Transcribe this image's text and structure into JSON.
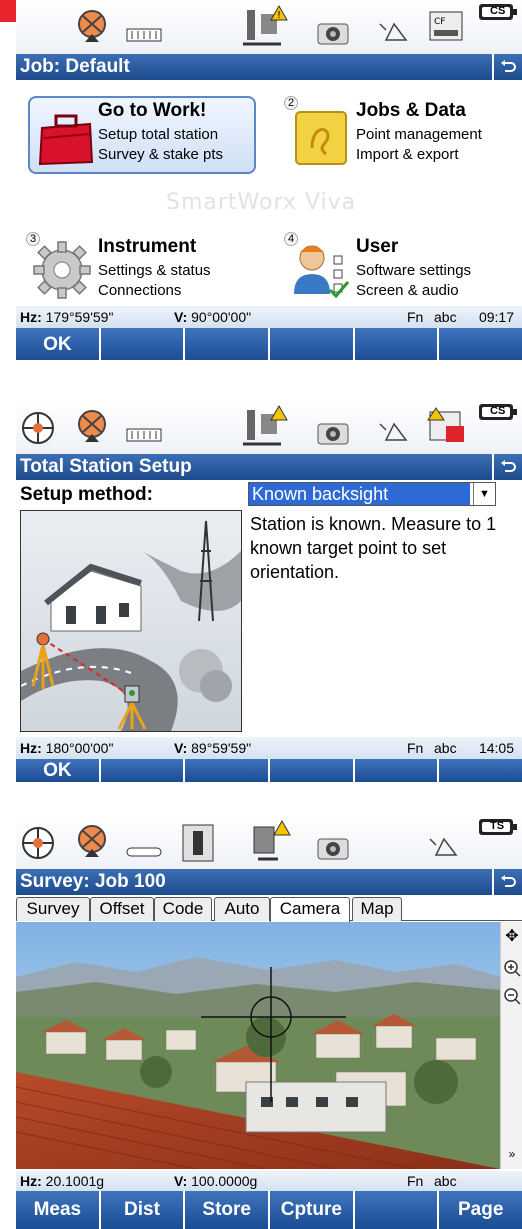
{
  "colors": {
    "accent_red": "#e8252c",
    "title_blue": "#1d4a8d",
    "selection_blue": "#2e6ad6"
  },
  "screen1": {
    "title": "Job: Default",
    "tiles": [
      {
        "number": "",
        "title": "Go to Work!",
        "line1": "Setup total station",
        "line2": "Survey & stake pts",
        "icon": "briefcase-icon"
      },
      {
        "number": "2",
        "title": "Jobs & Data",
        "line1": "Point management",
        "line2": "Import & export",
        "icon": "folder-icon"
      },
      {
        "number": "3",
        "title": "Instrument",
        "line1": "Settings & status",
        "line2": "Connections",
        "icon": "gear-icon"
      },
      {
        "number": "4",
        "title": "User",
        "line1": "Software settings",
        "line2": "Screen & audio",
        "icon": "user-icon"
      }
    ],
    "watermark": "SmartWorx Viva",
    "status": {
      "hz_label": "Hz:",
      "hz_value": "179°59'59\"",
      "v_label": "V:",
      "v_value": "90°00'00\"",
      "fn": "Fn",
      "abc": "abc",
      "time": "09:17"
    },
    "softkeys": [
      "OK",
      "",
      "",
      "",
      "",
      ""
    ],
    "badge": "CS"
  },
  "screen2": {
    "title": "Total Station Setup",
    "setup_label": "Setup method:",
    "setup_value": "Known backsight",
    "description": "Station is known. Measure to 1 known target point to set orientation.",
    "status": {
      "hz_label": "Hz:",
      "hz_value": "180°00'00\"",
      "v_label": "V:",
      "v_value": "89°59'59\"",
      "fn": "Fn",
      "abc": "abc",
      "time": "14:05"
    },
    "softkeys": [
      "OK",
      "",
      "",
      "",
      "",
      ""
    ],
    "badge": "CS"
  },
  "screen3": {
    "title": "Survey: Job 100",
    "tabs": [
      "Survey",
      "Offset",
      "Code",
      "Auto",
      "Camera",
      "Map"
    ],
    "active_tab": "Camera",
    "status": {
      "hz_label": "Hz:",
      "hz_value": "20.1001g",
      "v_label": "V:",
      "v_value": "100.0000g",
      "fn": "Fn",
      "abc": "abc"
    },
    "softkeys": [
      "Meas",
      "Dist",
      "Store",
      "Cpture",
      "",
      "Page"
    ],
    "badge": "TS"
  }
}
